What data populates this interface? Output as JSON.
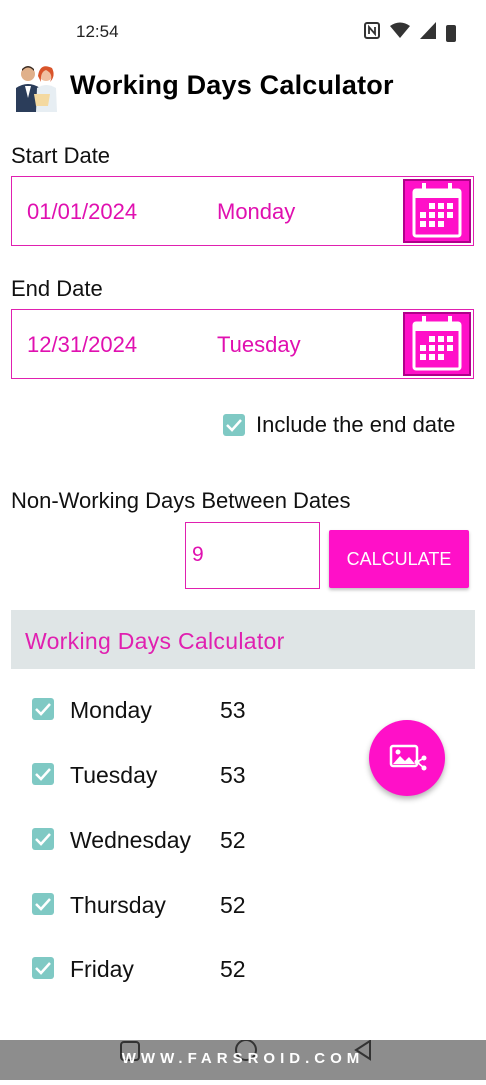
{
  "status_bar": {
    "time": "12:54"
  },
  "app": {
    "title": "Working Days Calculator"
  },
  "start_date": {
    "label": "Start Date",
    "date": "01/01/2024",
    "day": "Monday"
  },
  "end_date": {
    "label": "End Date",
    "date": "12/31/2024",
    "day": "Tuesday"
  },
  "include_end": {
    "label": "Include the end date",
    "checked": true
  },
  "non_working": {
    "label": "Non-Working Days Between Dates",
    "value": "9"
  },
  "calculate_button": {
    "label": "CALCULATE"
  },
  "results": {
    "header": "Working Days Calculator",
    "days": [
      {
        "name": "Monday",
        "count": "53",
        "checked": true
      },
      {
        "name": "Tuesday",
        "count": "53",
        "checked": true
      },
      {
        "name": "Wednesday",
        "count": "52",
        "checked": true
      },
      {
        "name": "Thursday",
        "count": "52",
        "checked": true
      },
      {
        "name": "Friday",
        "count": "52",
        "checked": true
      }
    ]
  },
  "watermark": "WWW.FARSROID.COM",
  "colors": {
    "accent": "#ff10c8",
    "checkbox": "#7fc9c4",
    "header_bg": "#dfe5e6"
  }
}
